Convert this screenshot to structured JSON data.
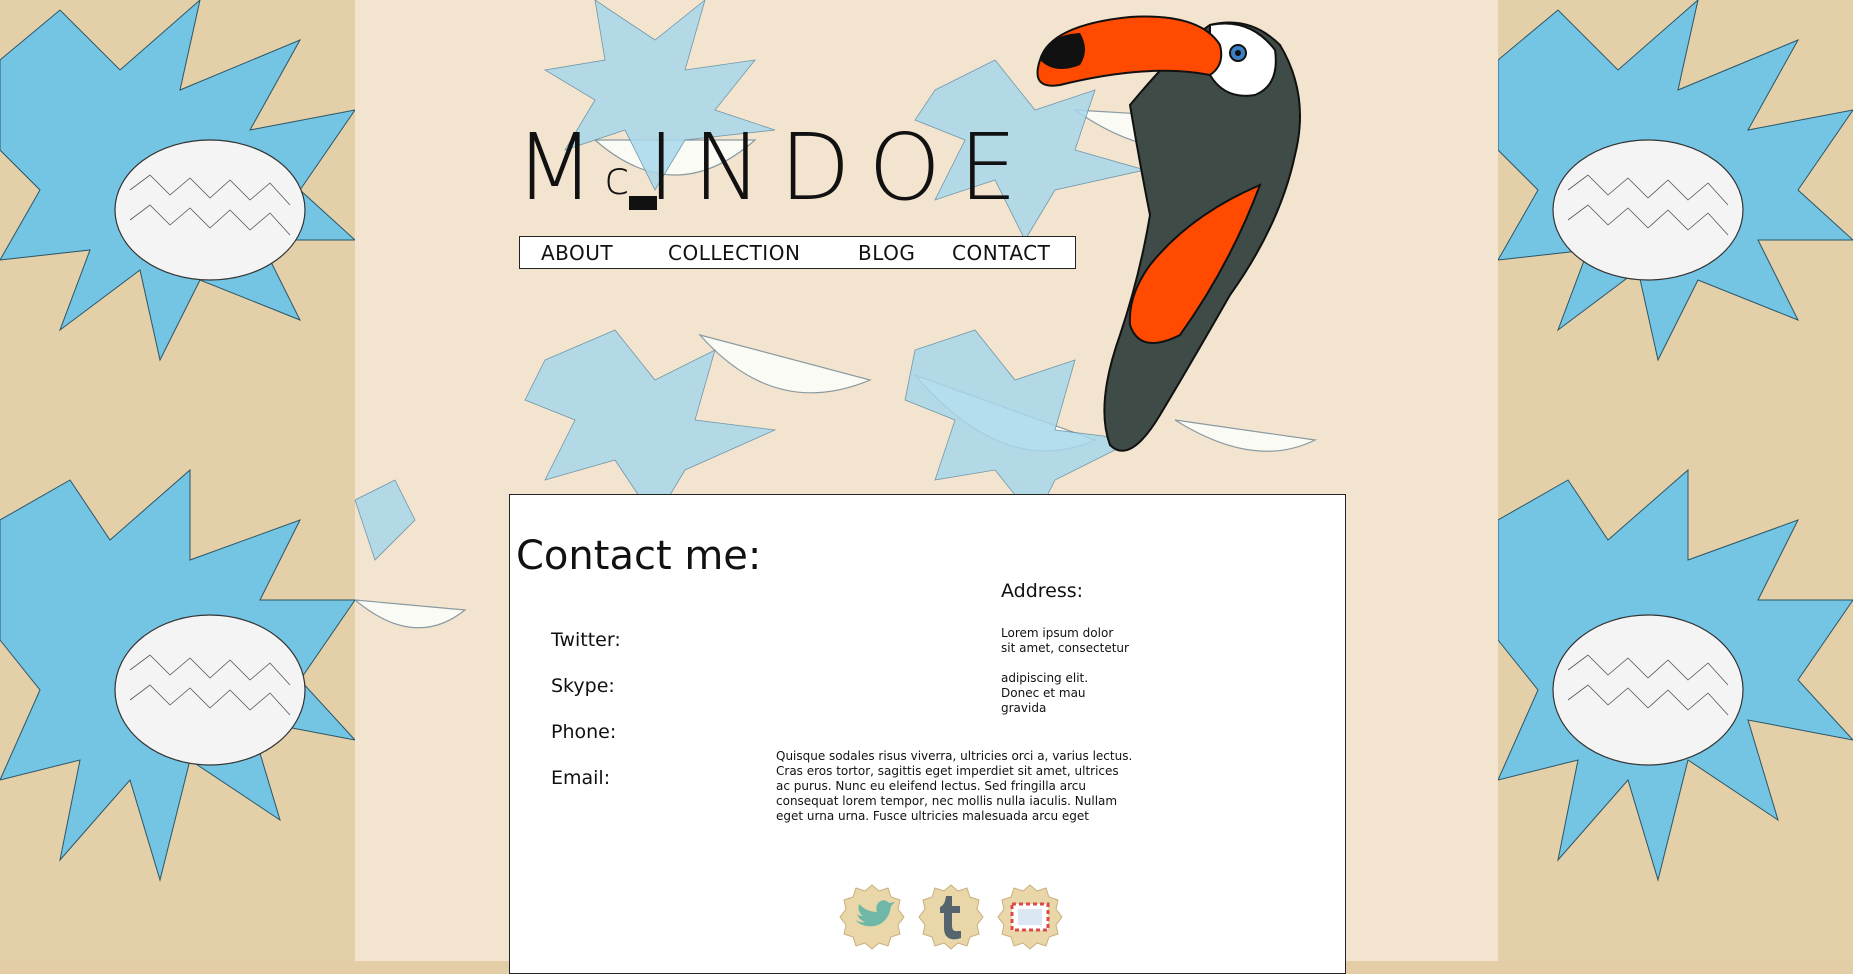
{
  "brand": {
    "logo_text": "M",
    "logo_c": "c",
    "logo_rest": "INDOE"
  },
  "nav": {
    "items": [
      {
        "label": "ABOUT"
      },
      {
        "label": "COLLECTION"
      },
      {
        "label": "BLOG"
      },
      {
        "label": "CONTACT"
      }
    ]
  },
  "contact": {
    "title": "Contact me:",
    "address_label": "Address:",
    "address_lines_1": "Lorem ipsum dolor\nsit amet, consectetur",
    "address_lines_2": "adipiscing elit.\nDonec et mau\ngravida",
    "fields": [
      {
        "label": "Twitter:"
      },
      {
        "label": "Skype:"
      },
      {
        "label": "Phone:"
      },
      {
        "label": "Email:"
      }
    ],
    "paragraph": "Quisque sodales risus viverra, ultricies orci a, varius lectus.\nCras eros tortor, sagittis eget imperdiet sit amet, ultrices\nac purus. Nunc eu eleifend lectus. Sed fringilla arcu\nconsequat lorem tempor, nec mollis nulla iaculis. Nullam\neget urna urna. Fusce ultricies malesuada arcu eget"
  },
  "social": [
    {
      "icon": "twitter-icon",
      "color": "#6fb8a8"
    },
    {
      "icon": "tumblr-icon",
      "color": "#56656d"
    },
    {
      "icon": "mail-icon",
      "color": "#d94b4b"
    }
  ],
  "colors": {
    "side_bg": "#e3cfa8",
    "center_bg": "#f3e4d0",
    "leaf_blue": "#74c5e4",
    "toucan_beak": "#ff4a00",
    "toucan_body": "#3e4b46"
  }
}
